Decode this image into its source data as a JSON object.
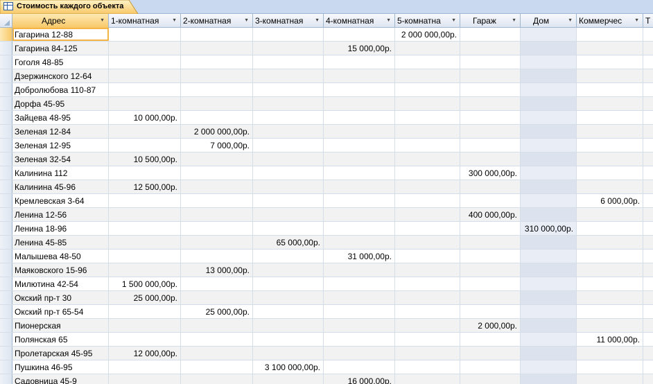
{
  "tab": {
    "title": "Стоимость каждого объекта",
    "icon": "table-icon"
  },
  "columns": [
    {
      "id": "address",
      "label": "Адрес"
    },
    {
      "id": "r1",
      "label": "1-комнатная"
    },
    {
      "id": "r2",
      "label": "2-комнатная"
    },
    {
      "id": "r3",
      "label": "3-комнатная"
    },
    {
      "id": "r4",
      "label": "4-комнатная"
    },
    {
      "id": "r5",
      "label": "5-комнатна"
    },
    {
      "id": "garage",
      "label": "Гараж"
    },
    {
      "id": "house",
      "label": "Дом"
    },
    {
      "id": "commercial",
      "label": "Коммерчес"
    },
    {
      "id": "more",
      "label": "Т"
    }
  ],
  "rows": [
    {
      "address": "Гагарина 12-88",
      "r5": "2 000 000,00р."
    },
    {
      "address": "Гагарина 84-125",
      "r4": "15 000,00р."
    },
    {
      "address": "Гоголя 48-85"
    },
    {
      "address": "Дзержинского 12-64"
    },
    {
      "address": "Добролюбова 110-87"
    },
    {
      "address": "Дорфа 45-95"
    },
    {
      "address": "Зайцева 48-95",
      "r1": "10 000,00р."
    },
    {
      "address": "Зеленая 12-84",
      "r2": "2 000 000,00р."
    },
    {
      "address": "Зеленая 12-95",
      "r2": "7 000,00р."
    },
    {
      "address": "Зеленая 32-54",
      "r1": "10 500,00р."
    },
    {
      "address": "Калинина 112",
      "garage": "300 000,00р."
    },
    {
      "address": "Калинина 45-96",
      "r1": "12 500,00р."
    },
    {
      "address": "Кремлевская 3-64",
      "commercial": "6 000,00р."
    },
    {
      "address": "Ленина 12-56",
      "garage": "400 000,00р."
    },
    {
      "address": "Ленина 18-96",
      "house": "310 000,00р."
    },
    {
      "address": "Ленина 45-85",
      "r3": "65 000,00р."
    },
    {
      "address": "Малышева 48-50",
      "r4": "31 000,00р."
    },
    {
      "address": "Маяковского 15-96",
      "r2": "13 000,00р."
    },
    {
      "address": "Милютина 42-54",
      "r1": "1 500 000,00р."
    },
    {
      "address": "Окский пр-т  30",
      "r1": "25 000,00р."
    },
    {
      "address": "Окский пр-т 65-54",
      "r2": "25 000,00р."
    },
    {
      "address": "Пионерская",
      "garage": "2 000,00р."
    },
    {
      "address": "Полянская 65",
      "commercial": "11 000,00р."
    },
    {
      "address": "Пролетарская 45-95",
      "r1": "12 000,00р."
    },
    {
      "address": "Пушкина 46-95",
      "r3": "3 100 000,00р."
    },
    {
      "address": "Садовница 45-9",
      "r4": "16 000,00р."
    }
  ]
}
